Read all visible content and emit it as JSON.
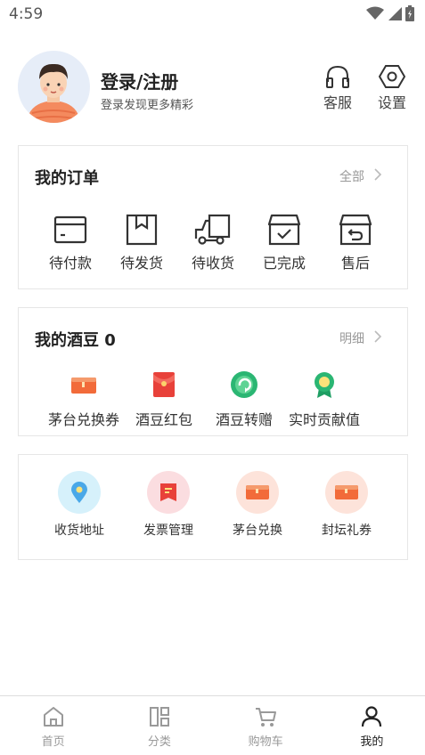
{
  "status_bar": {
    "time": "4:59",
    "icons": [
      "wifi-icon",
      "cellular-signal-icon",
      "battery-icon"
    ]
  },
  "profile": {
    "title": "登录/注册",
    "subtitle": "登录发现更多精彩",
    "service_label": "客服",
    "settings_label": "设置"
  },
  "orders": {
    "title": "我的订单",
    "all_label": "全部",
    "items": [
      {
        "label": "待付款",
        "icon": "wallet-icon"
      },
      {
        "label": "待发货",
        "icon": "package-icon"
      },
      {
        "label": "待收货",
        "icon": "truck-icon"
      },
      {
        "label": "已完成",
        "icon": "box-check-icon"
      },
      {
        "label": "售后",
        "icon": "box-return-icon"
      }
    ]
  },
  "beans": {
    "title": "我的酒豆 0",
    "detail_label": "明细",
    "items": [
      {
        "label": "茅台兑换券",
        "icon": "coupon-icon"
      },
      {
        "label": "酒豆红包",
        "icon": "red-envelope-icon"
      },
      {
        "label": "酒豆转赠",
        "icon": "transfer-icon"
      },
      {
        "label": "实时贡献值",
        "icon": "medal-icon"
      }
    ]
  },
  "services": {
    "items": [
      {
        "label": "收货地址",
        "icon": "location-pin-icon"
      },
      {
        "label": "发票管理",
        "icon": "invoice-icon"
      },
      {
        "label": "茅台兑换",
        "icon": "coupon-icon"
      },
      {
        "label": "封坛礼券",
        "icon": "coupon-icon"
      }
    ]
  },
  "nav": {
    "items": [
      {
        "label": "首页",
        "icon": "home-icon"
      },
      {
        "label": "分类",
        "icon": "category-icon"
      },
      {
        "label": "购物车",
        "icon": "cart-icon"
      },
      {
        "label": "我的",
        "icon": "user-icon",
        "active": true
      }
    ]
  },
  "colors": {
    "accent_orange": "#f26b3a",
    "accent_red": "#e8413a",
    "accent_green": "#2bb673",
    "accent_blue": "#49a8e8",
    "nav_active": "#222222",
    "nav_inactive": "#999999"
  }
}
